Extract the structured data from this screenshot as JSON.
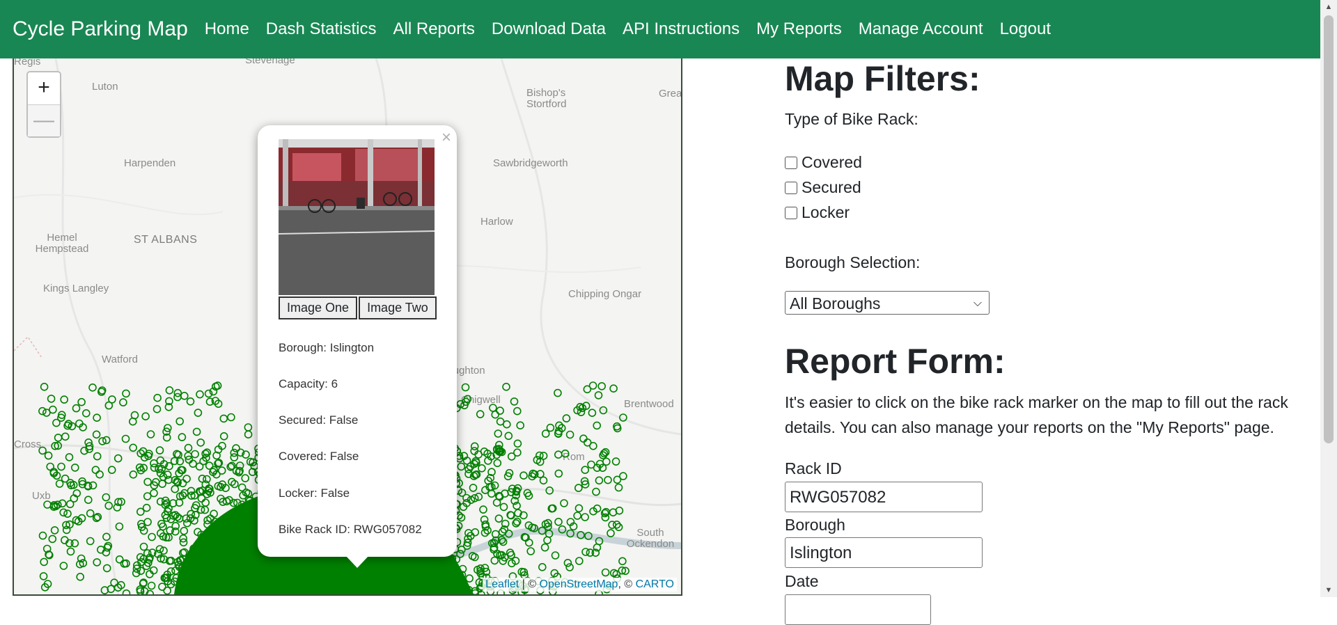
{
  "navbar": {
    "brand": "Cycle Parking Map",
    "links": [
      "Home",
      "Dash Statistics",
      "All Reports",
      "Download Data",
      "API Instructions",
      "My Reports",
      "Manage Account",
      "Logout"
    ]
  },
  "map": {
    "zoom_in": "+",
    "zoom_out": "—",
    "places": [
      "Luton",
      "Regis",
      "Stevenage",
      "Bishop's Stortford",
      "Grea",
      "Harpenden",
      "Sawbridgeworth",
      "Hemel Hempstead",
      "ST ALBANS",
      "Harlow",
      "Kings Langley",
      "Chipping Ongar",
      "Watford",
      "Loughton",
      "Chigwell",
      "Brentwood",
      "Cross",
      "Uxb",
      "Rom",
      "South Ockendon"
    ],
    "attribution": {
      "leaflet": "Leaflet",
      "sep": " | © ",
      "osm": "OpenStreetMap",
      "sep2": ", © ",
      "carto": "CARTO"
    },
    "marker_color": "#008000"
  },
  "popup": {
    "close": "×",
    "image_tabs": [
      "Image One",
      "Image Two"
    ],
    "borough": "Borough: Islington",
    "capacity": "Capacity: 6",
    "secured": "Secured: False",
    "covered": "Covered: False",
    "locker": "Locker: False",
    "rack_id": "Bike Rack ID: RWG057082"
  },
  "filters": {
    "title": "Map Filters:",
    "rack_type_label": "Type of Bike Rack:",
    "options": [
      "Covered",
      "Secured",
      "Locker"
    ],
    "borough_label": "Borough Selection:",
    "borough_selected": "All Boroughs"
  },
  "report": {
    "title": "Report Form:",
    "help": "It's easier to click on the bike rack marker on the map to fill out the rack details. You can also manage your reports on the \"My Reports\" page.",
    "rack_id_label": "Rack ID",
    "rack_id_value": "RWG057082",
    "borough_label": "Borough",
    "borough_value": "Islington",
    "date_label": "Date"
  },
  "colors": {
    "navbar": "#198754",
    "marker": "#008000"
  }
}
